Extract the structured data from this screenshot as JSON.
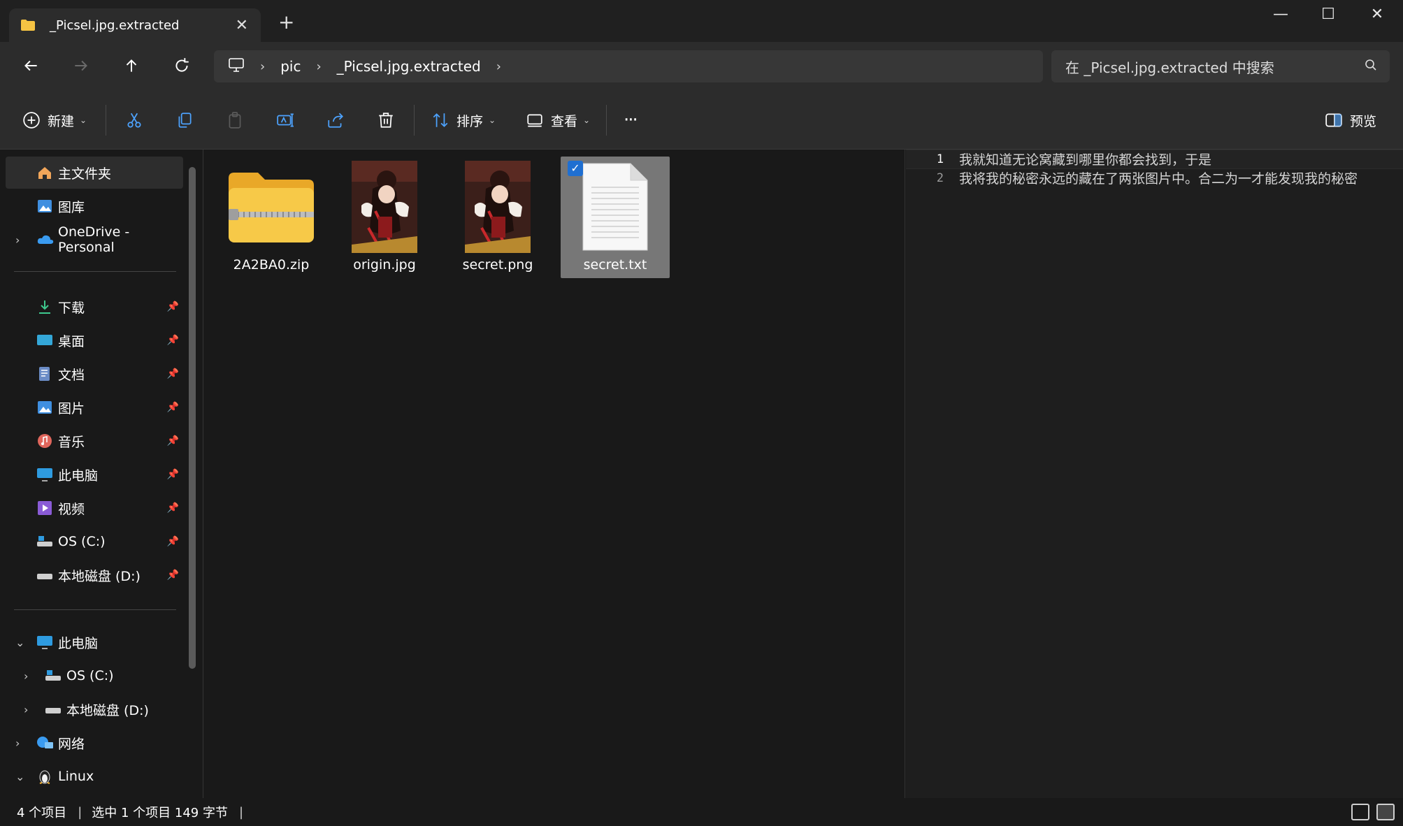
{
  "window": {
    "tab_title": "_Picsel.jpg.extracted",
    "tab_close": "✕",
    "new_tab": "+",
    "minimize": "—",
    "maximize": "☐",
    "close": "✕"
  },
  "address": {
    "crumbs": [
      "pic",
      "_Picsel.jpg.extracted"
    ],
    "search_placeholder": "在 _Picsel.jpg.extracted 中搜索"
  },
  "toolbar": {
    "new_label": "新建",
    "sort_label": "排序",
    "view_label": "查看",
    "more_label": "···",
    "preview_label": "预览"
  },
  "sidebar": {
    "home": "主文件夹",
    "gallery": "图库",
    "onedrive": "OneDrive - Personal",
    "quick": [
      {
        "label": "下载"
      },
      {
        "label": "桌面"
      },
      {
        "label": "文档"
      },
      {
        "label": "图片"
      },
      {
        "label": "音乐"
      },
      {
        "label": "此电脑"
      },
      {
        "label": "视频"
      },
      {
        "label": "OS (C:)"
      },
      {
        "label": "本地磁盘 (D:)"
      }
    ],
    "thispc": "此电脑",
    "drive_c": "OS (C:)",
    "drive_d": "本地磁盘 (D:)",
    "network": "网络",
    "linux": "Linux"
  },
  "files": [
    {
      "name": "2A2BA0.zip",
      "type": "zip-folder"
    },
    {
      "name": "origin.jpg",
      "type": "image"
    },
    {
      "name": "secret.png",
      "type": "image"
    },
    {
      "name": "secret.txt",
      "type": "text",
      "selected": true
    }
  ],
  "preview": {
    "lines": [
      {
        "num": "1",
        "text": "我就知道无论窝藏到哪里你都会找到，于是"
      },
      {
        "num": "2",
        "text": "我将我的秘密永远的藏在了两张图片中。合二为一才能发现我的秘密"
      }
    ]
  },
  "status": {
    "count": "4 个项目",
    "selection": "选中 1 个项目  149 字节",
    "sep": "|"
  },
  "colors": {
    "accent": "#1f6fd1",
    "folder": "#f5c343",
    "background": "#191919"
  }
}
